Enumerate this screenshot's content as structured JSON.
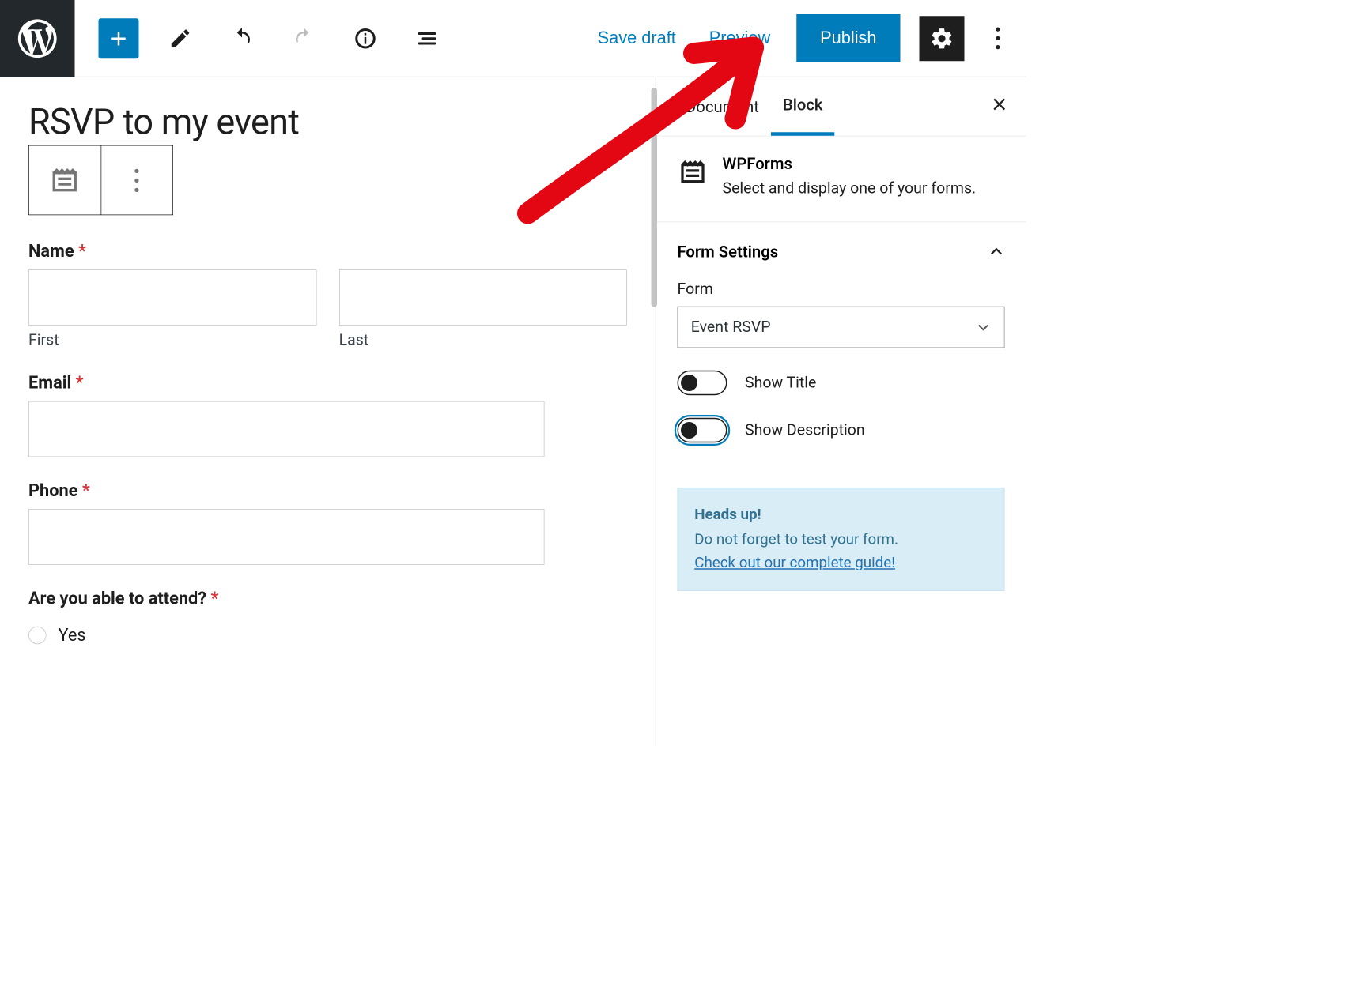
{
  "toolbar": {
    "save_draft": "Save draft",
    "preview": "Preview",
    "publish": "Publish"
  },
  "editor": {
    "title": "RSVP to my event",
    "fields": {
      "name": {
        "label": "Name",
        "required": "*",
        "first_sub": "First",
        "last_sub": "Last"
      },
      "email": {
        "label": "Email",
        "required": "*"
      },
      "phone": {
        "label": "Phone",
        "required": "*"
      },
      "attend": {
        "label": "Are you able to attend?",
        "required": "*",
        "options": [
          "Yes"
        ]
      }
    }
  },
  "sidebar": {
    "tabs": {
      "document": "Document",
      "block": "Block"
    },
    "block": {
      "title": "WPForms",
      "description": "Select and display one of your forms."
    },
    "form_settings": {
      "heading": "Form Settings",
      "form_label": "Form",
      "form_selected": "Event RSVP",
      "show_title": "Show Title",
      "show_description": "Show Description"
    },
    "notice": {
      "heading": "Heads up!",
      "body": "Do not forget to test your form.",
      "link": "Check out our complete guide!"
    }
  }
}
